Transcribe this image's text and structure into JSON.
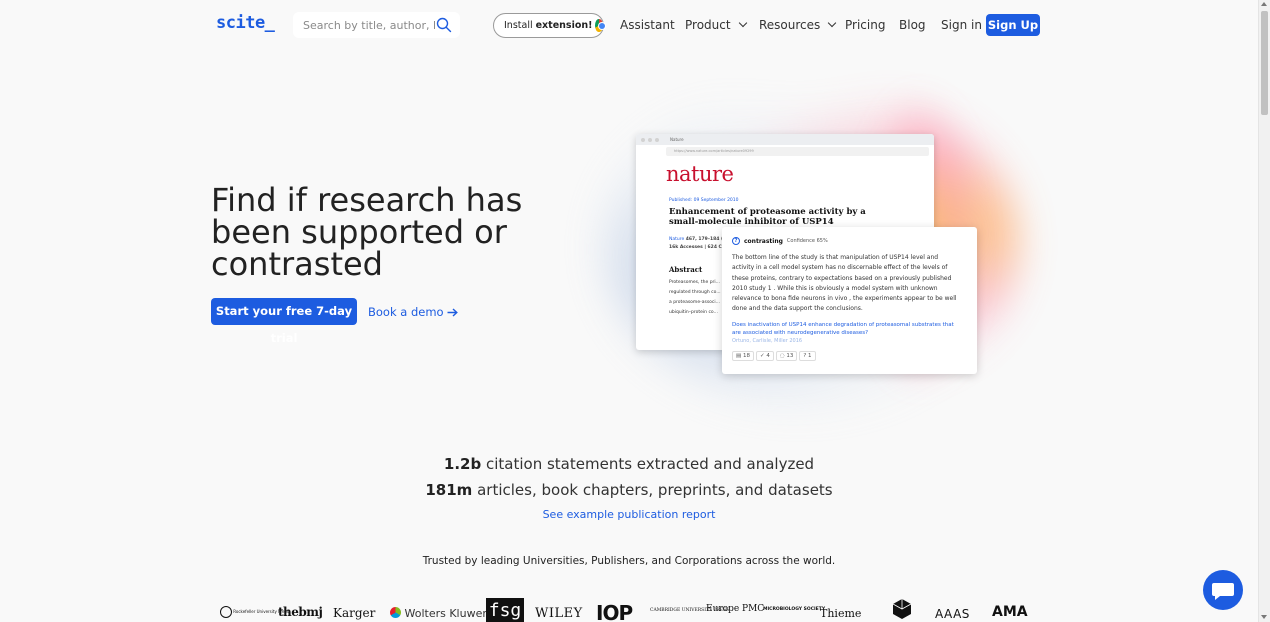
{
  "header": {
    "logo": "scite_",
    "search_placeholder": "Search by title, author, ke...",
    "install_text": "Install",
    "install_bold": "extension!",
    "nav": [
      "Assistant",
      "Product",
      "Resources",
      "Pricing",
      "Blog",
      "Sign in"
    ],
    "signup": "Sign Up"
  },
  "hero": {
    "title": "Find if research has been supported or contrasted",
    "cta": "Start your free 7-day trial",
    "demo": "Book a demo"
  },
  "illustration": {
    "tab_label": "Nature",
    "url": "https://www.nature.com/articles/nature09299",
    "journal": "nature",
    "published": "Published: 09 September 2010",
    "article_title": "Enhancement of proteasome activity by a small-molecule inhibitor of USP14",
    "meta_journal": "Nature",
    "meta_rest": "467, 179–184 (2010)",
    "meta_stats": "16k Accesses | 624 C",
    "abstract_title": "Abstract",
    "abstract_text": "Proteasomes, the pri... regulated through co... a proteasome-associ... ubiquitin–protein co...",
    "card_label": "contrasting",
    "card_confidence": "Confidence 65%",
    "card_text": "The bottom line of the study is that manipulation of USP14 level and activity in a cell model system has no discernable effect of the levels of these proteins, contrary to expectations based on a previously published 2010 study 1 . While this is obviously a model system with unknown relevance to bona fide neurons in vivo , the experiments appear to be well done and the data support the conclusions.",
    "card_link": "Does inactivation of USP14 enhance degradation of proteasomal substrates that are associated with neurodegenerative diseases?",
    "card_authors": "Ortuno, Carlisle, Miller 2016",
    "card_stats": [
      "18",
      "4",
      "13",
      "1"
    ]
  },
  "stats": {
    "line1_num": "1.2b",
    "line1_text": "citation statements extracted and analyzed",
    "line2_num": "181m",
    "line2_text": "articles, book chapters, preprints, and datasets",
    "example_link": "See example publication report",
    "trusted": "Trusted by leading Universities, Publishers, and Corporations across the world."
  },
  "logos": [
    "Rockefeller University Press",
    "thebmj",
    "Karger",
    "Wolters Kluwer",
    "fsg",
    "WILEY",
    "IOP",
    "CAMBRIDGE UNIVERSITY PRESS",
    "Europe PMC",
    "MICROBIOLOGY SOCIETY",
    "Thieme",
    "AAAS",
    "AMA"
  ],
  "colors": {
    "brand": "#1d5ce0",
    "background": "#f9f9f9",
    "nature_red": "#c8102e"
  }
}
